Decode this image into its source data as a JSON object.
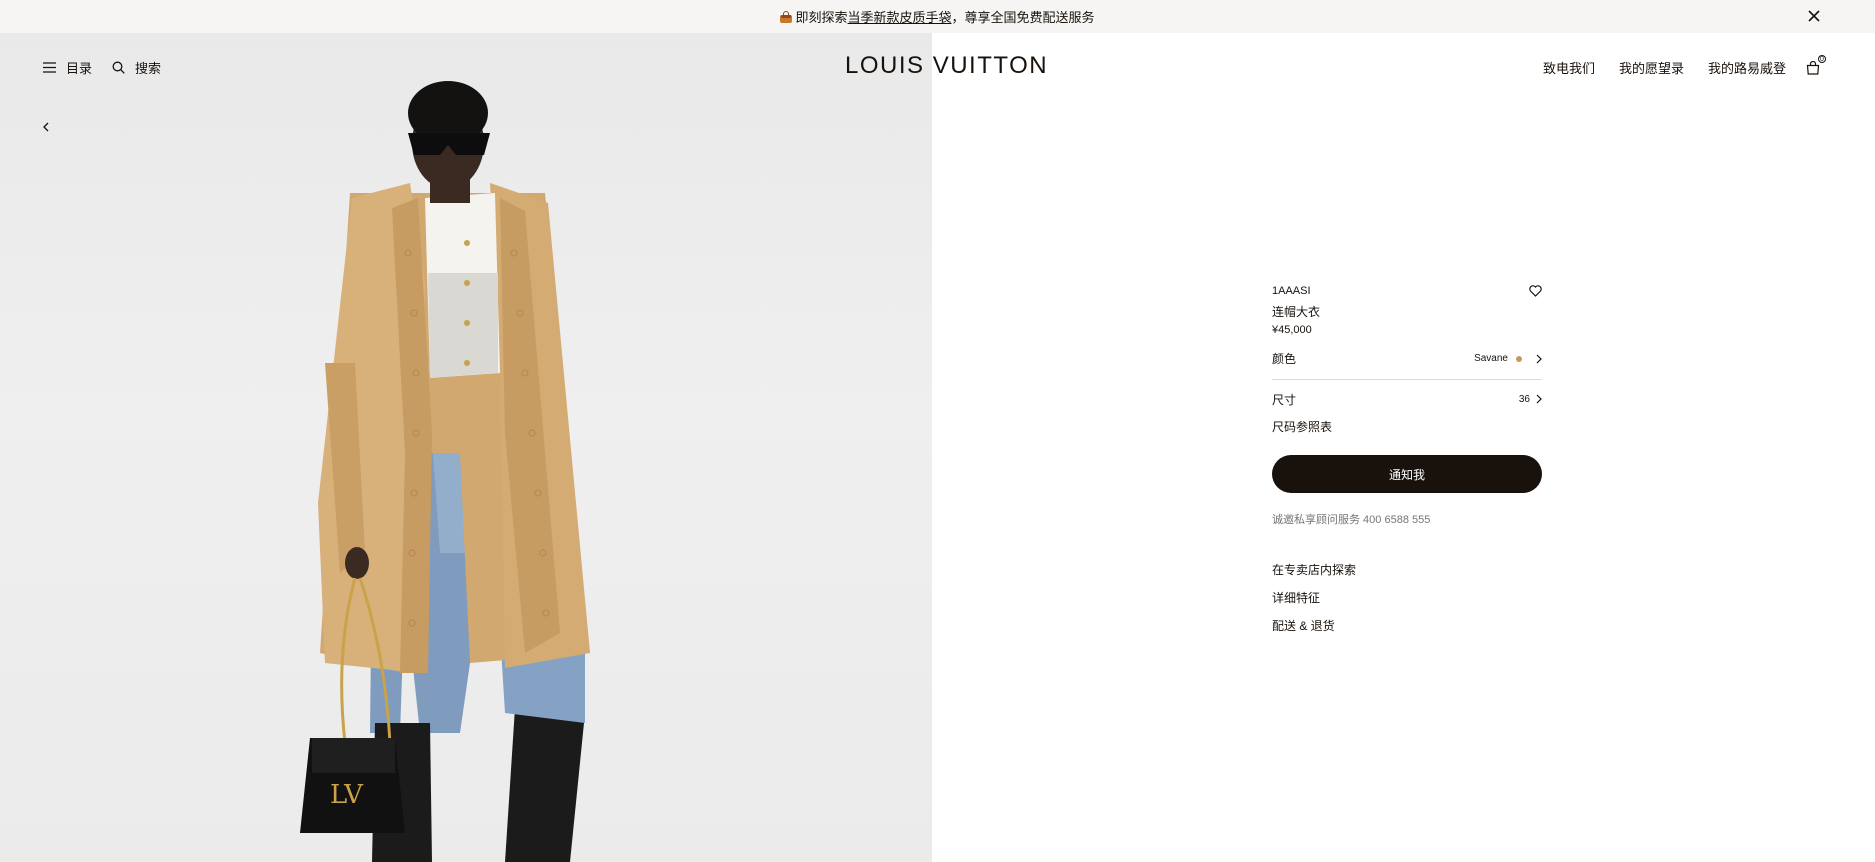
{
  "announcement": {
    "prefix": "即刻探索",
    "link": "当季新款皮质手袋",
    "suffix": "，尊享全国免费配送服务"
  },
  "header": {
    "menu_label": "目录",
    "search_label": "搜索",
    "logo": "LOUIS VUITTON",
    "nav": [
      "致电我们",
      "我的愿望录",
      "我的路易威登"
    ],
    "cart_count": "0"
  },
  "product": {
    "sku": "1AAASI",
    "name": "连帽大衣",
    "price": "¥45,000",
    "color_label": "颜色",
    "color_value": "Savane",
    "color_swatch": "#c49a5e",
    "size_label": "尺寸",
    "size_value": "36",
    "size_chart": "尺码参照表",
    "notify_button": "通知我",
    "advisor": "诚邀私享顾问服务 400 6588 555",
    "links": [
      "在专卖店内探索",
      "详细特征",
      "配送 & 退货"
    ]
  },
  "colors": {
    "primary": "#19110b",
    "announcement_bg": "#f6f5f3",
    "image_bg": "#ececec"
  }
}
